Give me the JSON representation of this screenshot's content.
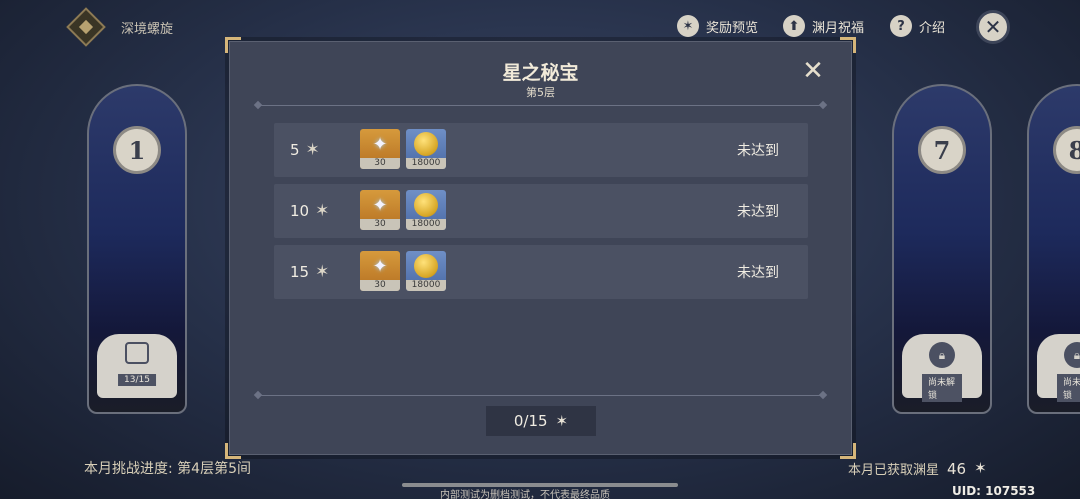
{
  "topbar": {
    "domain_title": "深境螺旋",
    "reward_preview_label": "奖励预览",
    "blessing_label": "渊月祝福",
    "intro_label": "介绍"
  },
  "chambers": [
    {
      "number": "1",
      "progress": "13/15",
      "state": "chest"
    },
    {
      "number": "7",
      "progress": "尚未解锁",
      "state": "locked"
    },
    {
      "number": "8",
      "progress": "尚未解锁",
      "state": "locked"
    }
  ],
  "modal": {
    "title": "星之秘宝",
    "subtitle": "第5层",
    "rewards": [
      {
        "stars": "5",
        "items": [
          {
            "icon": "primogem-icon",
            "count": "30"
          },
          {
            "icon": "mora-icon",
            "count": "18000"
          }
        ],
        "status": "未达到"
      },
      {
        "stars": "10",
        "items": [
          {
            "icon": "primogem-icon",
            "count": "30"
          },
          {
            "icon": "mora-icon",
            "count": "18000"
          }
        ],
        "status": "未达到"
      },
      {
        "stars": "15",
        "items": [
          {
            "icon": "primogem-icon",
            "count": "30"
          },
          {
            "icon": "mora-icon",
            "count": "18000"
          }
        ],
        "status": "未达到"
      }
    ],
    "total": "0/15"
  },
  "footer": {
    "month_progress": "本月挑战进度: 第4层第5间",
    "month_stars_label": "本月已获取渊星",
    "month_stars_value": "46",
    "watermark": "内部测试为删档测试，不代表最终品质",
    "uid": "UID: 107553"
  },
  "colors": {
    "accent_gold": "#d6b67a",
    "panel_bg": "#3f4557",
    "row_bg": "#4b5163"
  }
}
